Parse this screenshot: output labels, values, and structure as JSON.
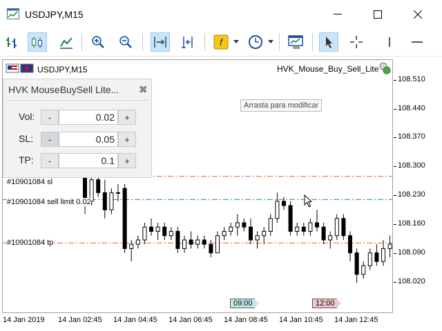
{
  "window": {
    "title": "USDJPY,M15"
  },
  "toolbar": {
    "buttons": [
      "bar-chart-icon",
      "candlestick-icon",
      "line-chart-icon",
      "zoom-in-icon",
      "zoom-out-icon",
      "chart-shift-icon",
      "autoscroll-icon",
      "indicators-icon",
      "periods-icon",
      "templates-icon",
      "cursor-icon",
      "crosshair-icon",
      "vertical-line-icon",
      "horizontal-line-icon"
    ]
  },
  "chart": {
    "symbol_label": "USDJPY,M15",
    "ea_name": "HVK_Mouse_Buy_Sell_Lite",
    "tooltip": "Arrasta para modificar",
    "orders": {
      "sl_label": "#10901084 sl",
      "sell_limit_label": "#10901084 sell limit 0.02",
      "tp_label": "#10901084 tp"
    },
    "time_badges": [
      "09:00",
      "12:00"
    ],
    "colors": {
      "sl_line": "#e0642a",
      "entry_line": "#2e9e2e",
      "tp_line": "#e0642a",
      "badge_blue": "#c8e8e8",
      "badge_red": "#f2c8cc"
    }
  },
  "chart_data": {
    "type": "candlestick",
    "price_ticks": [
      "108.510",
      "108.440",
      "108.370",
      "108.300",
      "108.230",
      "108.160",
      "108.090",
      "108.020"
    ],
    "time_ticks": [
      "14 Jan 2019",
      "14 Jan 02:45",
      "14 Jan 04:45",
      "14 Jan 06:45",
      "14 Jan 08:45",
      "14 Jan 10:45",
      "14 Jan 12:45"
    ],
    "ylim": [
      107.94,
      108.53
    ],
    "levels": {
      "sl": 108.258,
      "entry": 108.204,
      "tp": 108.103
    },
    "candles": [
      [
        108.26,
        108.28,
        108.17,
        108.2
      ],
      [
        108.2,
        108.26,
        108.19,
        108.25
      ],
      [
        108.25,
        108.26,
        108.21,
        108.22
      ],
      [
        108.22,
        108.25,
        108.16,
        108.18
      ],
      [
        108.18,
        108.23,
        108.17,
        108.22
      ],
      [
        108.22,
        108.24,
        108.2,
        108.22
      ],
      [
        108.23,
        108.24,
        108.08,
        108.09
      ],
      [
        108.09,
        108.11,
        108.06,
        108.1
      ],
      [
        108.1,
        108.12,
        108.09,
        108.11
      ],
      [
        108.11,
        108.15,
        108.1,
        108.14
      ],
      [
        108.14,
        108.16,
        108.12,
        108.13
      ],
      [
        108.13,
        108.15,
        108.11,
        108.14
      ],
      [
        108.14,
        108.15,
        108.11,
        108.12
      ],
      [
        108.12,
        108.14,
        108.11,
        108.13
      ],
      [
        108.13,
        108.14,
        108.08,
        108.09
      ],
      [
        108.09,
        108.12,
        108.08,
        108.11
      ],
      [
        108.11,
        108.13,
        108.09,
        108.1
      ],
      [
        108.1,
        108.12,
        108.09,
        108.11
      ],
      [
        108.11,
        108.12,
        108.09,
        108.1
      ],
      [
        108.1,
        108.11,
        108.07,
        108.08
      ],
      [
        108.08,
        108.13,
        108.08,
        108.12
      ],
      [
        108.12,
        108.14,
        108.11,
        108.13
      ],
      [
        108.13,
        108.15,
        108.12,
        108.14
      ],
      [
        108.14,
        108.17,
        108.12,
        108.15
      ],
      [
        108.15,
        108.16,
        108.13,
        108.14
      ],
      [
        108.14,
        108.16,
        108.1,
        108.11
      ],
      [
        108.11,
        108.13,
        108.09,
        108.12
      ],
      [
        108.12,
        108.14,
        108.1,
        108.13
      ],
      [
        108.13,
        108.17,
        108.12,
        108.16
      ],
      [
        108.16,
        108.22,
        108.15,
        108.2
      ],
      [
        108.2,
        108.21,
        108.18,
        108.19
      ],
      [
        108.19,
        108.2,
        108.12,
        108.13
      ],
      [
        108.13,
        108.15,
        108.12,
        108.14
      ],
      [
        108.14,
        108.15,
        108.12,
        108.13
      ],
      [
        108.13,
        108.16,
        108.12,
        108.15
      ],
      [
        108.15,
        108.18,
        108.13,
        108.14
      ],
      [
        108.14,
        108.15,
        108.1,
        108.11
      ],
      [
        108.11,
        108.13,
        108.09,
        108.12
      ],
      [
        108.12,
        108.17,
        108.11,
        108.16
      ],
      [
        108.16,
        108.17,
        108.11,
        108.12
      ],
      [
        108.12,
        108.13,
        108.06,
        108.08
      ],
      [
        108.08,
        108.09,
        108.01,
        108.03
      ],
      [
        108.03,
        108.06,
        108.02,
        108.05
      ],
      [
        108.05,
        108.09,
        108.04,
        108.08
      ],
      [
        108.08,
        108.1,
        108.05,
        108.06
      ],
      [
        108.06,
        108.11,
        108.05,
        108.09
      ],
      [
        108.09,
        108.12,
        108.07,
        108.1
      ]
    ],
    "grid": false
  },
  "panel": {
    "title": "HVK MouseBuySell Lite...",
    "close_glyph": "✖",
    "rows": [
      {
        "label": "Vol:",
        "minus": "-",
        "value": "0.02",
        "plus": "+"
      },
      {
        "label": "SL:",
        "minus": "-",
        "value": "0.05",
        "plus": "+"
      },
      {
        "label": "TP:",
        "minus": "-",
        "value": "0.1",
        "plus": "+"
      }
    ]
  }
}
